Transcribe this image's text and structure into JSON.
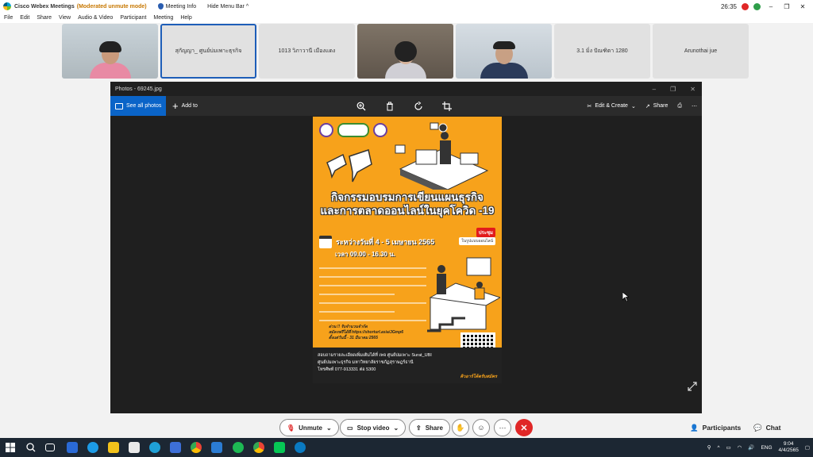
{
  "titlebar": {
    "app_name": "Cisco Webex Meetings",
    "mode": "(Moderated unmute mode)",
    "meeting_info": "Meeting Info",
    "hide_menu_bar": "Hide Menu Bar",
    "timer": "26:35"
  },
  "menu": [
    "File",
    "Edit",
    "Share",
    "View",
    "Audio & Video",
    "Participant",
    "Meeting",
    "Help"
  ],
  "participants": [
    {
      "name": "",
      "video": true
    },
    {
      "name": "สุกัญญา_ ศูนย์บ่มเพาะธุรกิจ",
      "video": false,
      "active": true
    },
    {
      "name": "1013 วิภาวานี เมืองแดง",
      "video": false
    },
    {
      "name": "",
      "video": true
    },
    {
      "name": "",
      "video": true
    },
    {
      "name": "3.1 มิ่ง ปัณฑิตา 1280",
      "video": false
    },
    {
      "name": "Arunothai jue",
      "video": false
    }
  ],
  "photos": {
    "window_title": "Photos - 69245.jpg",
    "see_all": "See all photos",
    "add_to": "Add to",
    "edit_create": "Edit & Create",
    "share": "Share"
  },
  "poster": {
    "headline_1": "กิจกรรมอบรมการเขียนแผนธุรกิจ",
    "headline_2": "และการตลาดออนไลน์ในยุคโควิด -19",
    "date": "ระหว่างวันที่ 4 - 5 เมษายน 2565",
    "time": "เวลา 09.00 - 16.30 น.",
    "online_badge": "ประชุม",
    "online_sub": "ในรูปแบบออนไลน์",
    "register_1": "ด่วน !! รับจำนวนจำกัด",
    "register_2": "สมัครฟรีได้ที่ https://shorturl.asia/JGmp6",
    "register_3": "ตั้งแต่วันนี้ - 31 มีนาคม 2565",
    "contact_1": "สอบถามรายละเอียดเพิ่มเติมได้ที่   เพจ ศูนย์บ่มเพาะ    Surat_UBI",
    "contact_2": "ศูนย์บ่มเพาะธุรกิจ มหาวิทยาลัยราชภัฏสุราษฎร์ธานี",
    "contact_3": "โทรศัพท์ 077-913331 ต่อ 5300",
    "register_button": "คิวอาร์โค้ดรับสมัคร"
  },
  "controls": {
    "unmute": "Unmute",
    "stop_video": "Stop video",
    "share": "Share",
    "participants": "Participants",
    "chat": "Chat"
  },
  "taskbar": {
    "lang": "ENG",
    "time": "9:04",
    "date": "4/4/2565"
  },
  "colors": {
    "poster_orange": "#f7a21b",
    "webex_blue": "#1e5eb8",
    "end_call_red": "#e02727",
    "photos_blue": "#0a64c8"
  }
}
